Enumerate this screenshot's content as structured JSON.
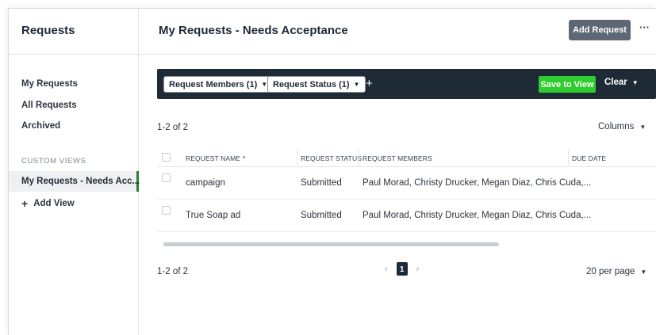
{
  "sidebar": {
    "title": "Requests",
    "items": [
      "My Requests",
      "All Requests",
      "Archived"
    ],
    "section_label": "CUSTOM VIEWS",
    "active_view": "My Requests - Needs Acc...",
    "add_view": "Add View",
    "add_icon": "+"
  },
  "header": {
    "title": "My Requests - Needs Acceptance",
    "add_button": "Add Request",
    "more_icon": "···"
  },
  "filters": {
    "chips": [
      "Request Members (1)",
      "Request Status (1)"
    ],
    "chevron": "⌄",
    "add_icon": "+",
    "save_view": "Save to View",
    "clear": "Clear"
  },
  "table": {
    "count_top": "1-2 of 2",
    "columns_label": "Columns",
    "headers": {
      "name": "REQUEST NAME",
      "sort_icon": "^",
      "status": "REQUEST STATUS",
      "members": "REQUEST MEMBERS",
      "due": "DUE DATE"
    },
    "rows": [
      {
        "name": "campaign",
        "status": "Submitted",
        "members": "Paul Morad, Christy Drucker, Megan Diaz, Chris Cuda,...",
        "due": ""
      },
      {
        "name": "True Soap ad",
        "status": "Submitted",
        "members": "Paul Morad, Christy Drucker, Megan Diaz, Chris Cuda,...",
        "due": ""
      }
    ]
  },
  "pagination": {
    "count_bottom": "1-2 of 2",
    "prev": "‹",
    "current_page": "1",
    "next": "›",
    "per_page": "20 per page"
  },
  "colors": {
    "filter_bar": "#1f2a37",
    "save_button": "#2ecc2e",
    "add_button": "#5d6874",
    "active_marker": "#2f7d32"
  }
}
